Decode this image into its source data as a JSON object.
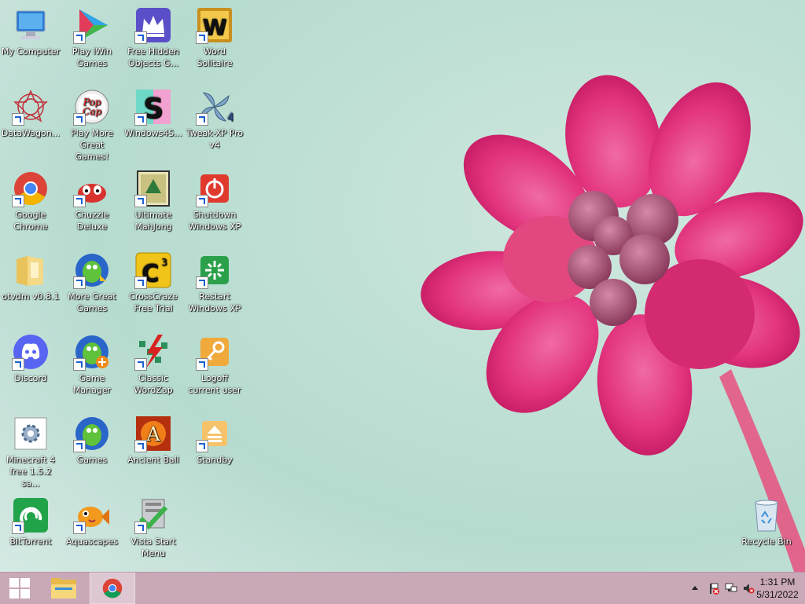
{
  "desktop": {
    "icons": [
      {
        "label": "My Computer"
      },
      {
        "label": "Play iWin Games"
      },
      {
        "label": "Free Hidden Objects G..."
      },
      {
        "label": "Word Solitaire"
      },
      {
        "label": "DataWagon..."
      },
      {
        "label": "Play More Great Games!"
      },
      {
        "label": "Windows4S..."
      },
      {
        "label": "Tweak-XP Pro v4"
      },
      {
        "label": "Google Chrome"
      },
      {
        "label": "Chuzzle Deluxe"
      },
      {
        "label": "Ultimate MahJong"
      },
      {
        "label": "Shutdown Windows XP"
      },
      {
        "label": "otvdm v0.8.1"
      },
      {
        "label": "More Great Games"
      },
      {
        "label": "CrossCraze Free Trial"
      },
      {
        "label": "Restart Windows XP"
      },
      {
        "label": "Discord"
      },
      {
        "label": "Game Manager"
      },
      {
        "label": "Classic WordZap"
      },
      {
        "label": "Logoff current user"
      },
      {
        "label": "Minecraft 4 free 1.5.2 sa..."
      },
      {
        "label": "Games"
      },
      {
        "label": "Ancient Ball"
      },
      {
        "label": "Standby"
      },
      {
        "label": "BitTorrent"
      },
      {
        "label": "Aquascapes"
      },
      {
        "label": "Vista Start Menu"
      },
      {
        "label": "Recycle Bin"
      }
    ]
  },
  "taskbar": {
    "clock_time": "1:31 PM",
    "clock_date": "5/31/2022"
  },
  "colors": {
    "taskbar": "#c9a8b8",
    "wallpaper_bg": "#bfe0d5",
    "flower": "#e0307a"
  }
}
